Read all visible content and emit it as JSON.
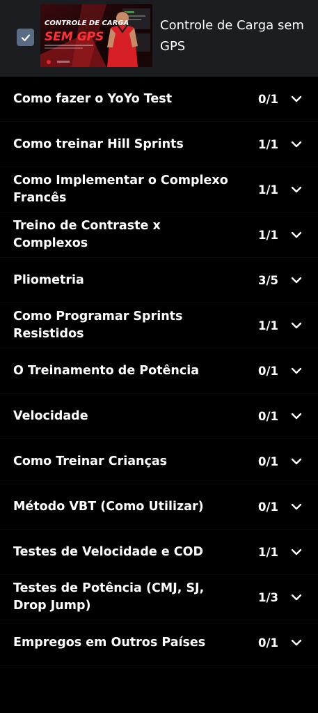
{
  "header": {
    "checked": true,
    "thumbnail": {
      "headline_1": "CONTROLE DE CARGA",
      "headline_2": "SEM GPS"
    },
    "title": "Controle de Carga sem GPS"
  },
  "modules": [
    {
      "label": "Como fazer o YoYo Test",
      "progress": "0/1"
    },
    {
      "label": "Como treinar Hill Sprints",
      "progress": "1/1"
    },
    {
      "label": "Como Implementar o Complexo Francês",
      "progress": "1/1"
    },
    {
      "label": "Treino de Contraste x Complexos",
      "progress": "1/1"
    },
    {
      "label": "Pliometria",
      "progress": "3/5"
    },
    {
      "label": "Como Programar Sprints Resistidos",
      "progress": "1/1"
    },
    {
      "label": "O Treinamento de Potência",
      "progress": "0/1"
    },
    {
      "label": "Velocidade",
      "progress": "0/1"
    },
    {
      "label": "Como Treinar Crianças",
      "progress": "0/1"
    },
    {
      "label": "Método VBT (Como Utilizar)",
      "progress": "0/1"
    },
    {
      "label": "Testes de Velocidade e COD",
      "progress": "1/1"
    },
    {
      "label": "Testes de Potência (CMJ, SJ, Drop Jump)",
      "progress": "1/3"
    },
    {
      "label": "Empregos em Outros Países",
      "progress": "0/1"
    }
  ],
  "colors": {
    "header_bg": "#1b1d21",
    "list_bg": "#000000",
    "checkbox": "#5a6b86",
    "thumb_accent": "#e02b2b"
  }
}
